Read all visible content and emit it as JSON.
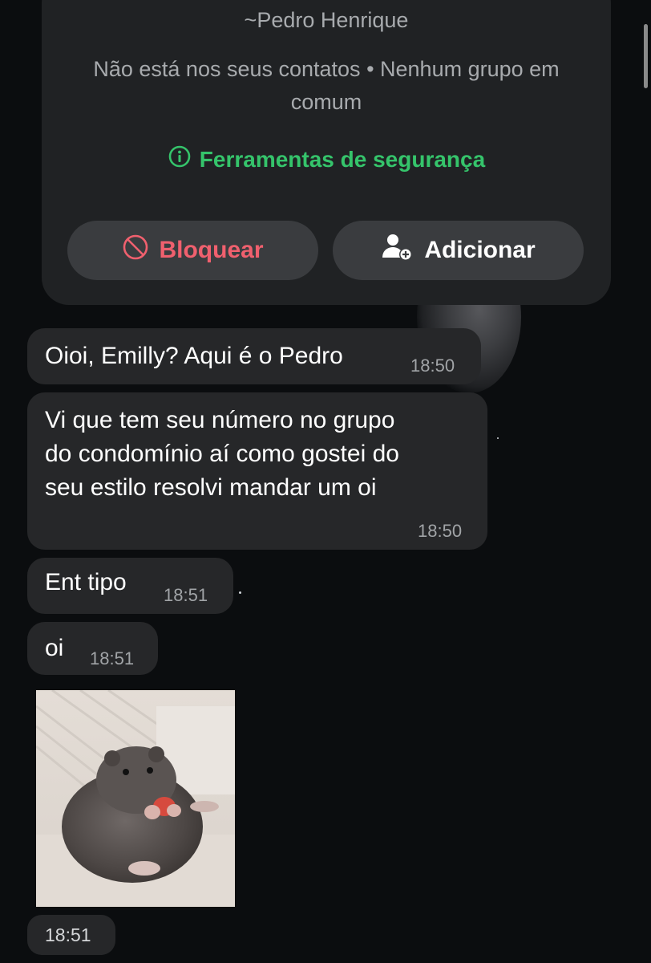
{
  "contact": {
    "name": "~Pedro Henrique",
    "meta": "Não está nos seus contatos • Nenhum grupo em comum",
    "safety_tools_label": "Ferramentas de segurança",
    "block_label": "Bloquear",
    "add_label": "Adicionar"
  },
  "messages": [
    {
      "text": "Oioi, Emilly? Aqui é o Pedro",
      "time": "18:50"
    },
    {
      "lines": [
        "Vi que tem seu número no grupo",
        "do condomínio aí como gostei do",
        "seu estilo resolvi mandar um oi"
      ],
      "time": "18:50"
    },
    {
      "text": "Ent tipo",
      "time": "18:51"
    },
    {
      "text": "oi",
      "time": "18:51"
    },
    {
      "type": "image",
      "image_alt": "hamster-photo",
      "time": "18:51"
    }
  ],
  "colors": {
    "safety_green": "#35c46b",
    "block_red": "#f0606e",
    "bubble_bg": "#262729",
    "card_bg": "#202224"
  }
}
